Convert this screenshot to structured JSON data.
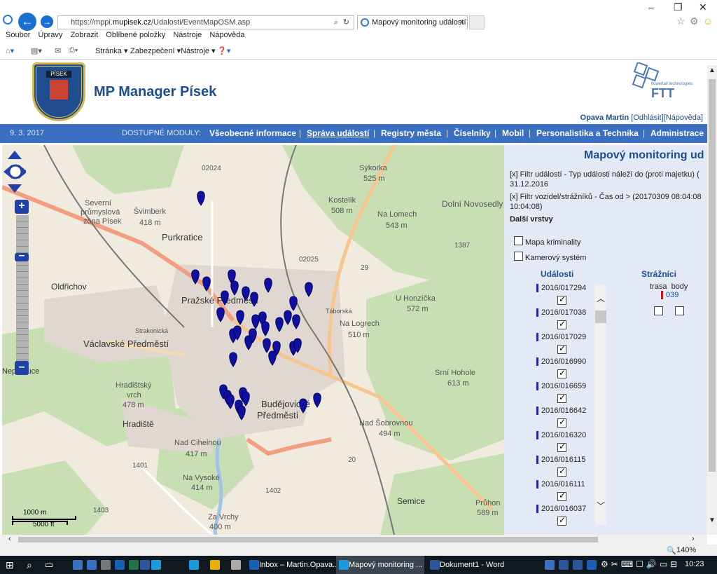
{
  "browser": {
    "url_prefix": "https://mppi.",
    "url_host": "mupisek.cz",
    "url_path": "/Udalosti/EventMapOSM.asp",
    "tab_title": "Mapový monitoring událostí",
    "menu": [
      "Soubor",
      "Úpravy",
      "Zobrazit",
      "Oblíbené položky",
      "Nástroje",
      "Nápověda"
    ],
    "commands": [
      "Stránka ▾",
      "Zabezpečení ▾",
      "Nástroje ▾"
    ],
    "zoom": "140%"
  },
  "site": {
    "logo_text": "PÍSEK",
    "title": "MP Manager Písek",
    "brand": "FTT",
    "brand_sub": "flowertail technologies",
    "user": "Opava Martin",
    "logout": "[Odhlásit]",
    "help": "[Nápověda]"
  },
  "modules": {
    "date": "9. 3. 2017",
    "label": "DOSTUPNÉ MODULY:",
    "items": [
      "Všeobecné informace",
      "Správa událostí",
      "Registry města",
      "Číselníky",
      "Mobil",
      "Personalistika a Technika",
      "Administrace"
    ]
  },
  "map": {
    "labels": [
      "02024",
      "Sýkorka",
      "525 m",
      "Severní",
      "průmyslová",
      "zóna Písek",
      "Švimberk",
      "418 m",
      "Kostelík",
      "508 m",
      "Dolní Novosedly",
      "Na Lomech",
      "543 m",
      "Purkratice",
      "1387",
      "02025",
      "29",
      "Oldřichov",
      "Pražské Předměstí",
      "Táborská",
      "U Honzíčka",
      "572 m",
      "Strakonická",
      "Na Logrech",
      "510 m",
      "Václavské Předměstí",
      "Nepomuce",
      "Hradištský",
      "vrch",
      "478 m",
      "Srní Hohole",
      "613 m",
      "Budějovické",
      "Předměstí",
      "Hradiště",
      "Nad Cihelnou",
      "417 m",
      "Nad Šobrovnou",
      "494 m",
      "Na Vysoké",
      "414 m",
      "1401",
      "1402",
      "20",
      "1403",
      "Semice",
      "Průhon",
      "589 m",
      "Za Vrchy",
      "400 m",
      "1000 m",
      "5000 ft"
    ],
    "scale_m": "1000 m",
    "scale_ft": "5000 ft"
  },
  "panel": {
    "title": "Mapový monitoring ud",
    "filter1a": "[x] Filtr událostí - Typ události náleží do (proti majetku) (",
    "filter1b": "31.12.2016",
    "filter2a": "[x] Filtr vozidel/strážníků - Čas od > (20170309 08:04:08",
    "filter2b": "10:04:08)",
    "more_layers": "Další vrstvy",
    "layers": [
      "Mapa kriminality",
      "Kamerový systém"
    ],
    "events_title": "Události",
    "guards_title": "Strážníci",
    "events": [
      "2016/017294",
      "2016/017038",
      "2016/017029",
      "2016/016990",
      "2016/016659",
      "2016/016642",
      "2016/016320",
      "2016/016115",
      "2016/016111",
      "2016/016037"
    ],
    "guards_head": "trasa  body",
    "guard_id": "039"
  },
  "taskbar": {
    "items": [
      "Inbox – Martin.Opava...",
      "Mapový monitoring ...",
      "Dokument1 - Word"
    ],
    "time": "10:23"
  },
  "colors": {
    "accent": "#3a6fc1",
    "title_blue": "#1f4d8f",
    "marker": "#1010a0",
    "panel_bg": "#e3e9f5"
  }
}
